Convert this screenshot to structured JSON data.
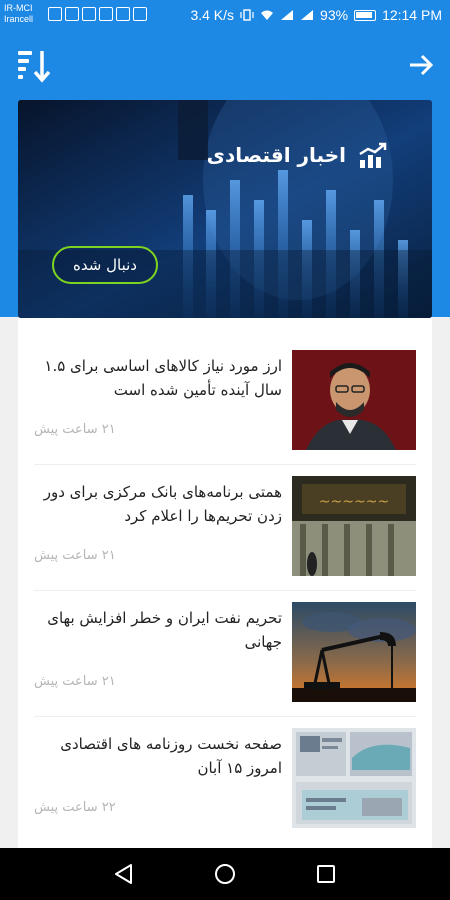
{
  "status_bar": {
    "carrier_line1": "IR-MCI",
    "carrier_line2": "Irancell",
    "speed": "3.4 K/s",
    "battery_percent": "93%",
    "time": "12:14 PM"
  },
  "app_bar": {
    "sort_icon": "sort-descending-icon",
    "back_icon": "arrow-forward-icon"
  },
  "hero": {
    "title": "اخبار اقتصادی",
    "icon": "chart-trend-icon",
    "follow_label": "دنبال شده",
    "accent_color": "#7ed321"
  },
  "news": [
    {
      "title": "ارز مورد نیاز کالاهای اساسی برای ۱.۵ سال آینده تأمین شده است",
      "time": "۲۱ ساعت پیش"
    },
    {
      "title": "همتی برنامه‌های بانک مرکزی برای دور زدن تحریم‌ها را اعلام کرد",
      "time": "۲۱ ساعت پیش"
    },
    {
      "title": "تحریم نفت ایران و خطر افزایش بهای جهانی",
      "time": "۲۱ ساعت پیش"
    },
    {
      "title": "صفحه نخست روزنامه های اقتصادی امروز ۱۵ آبان",
      "time": "۲۲ ساعت پیش"
    }
  ],
  "colors": {
    "primary": "#1e88e5"
  }
}
